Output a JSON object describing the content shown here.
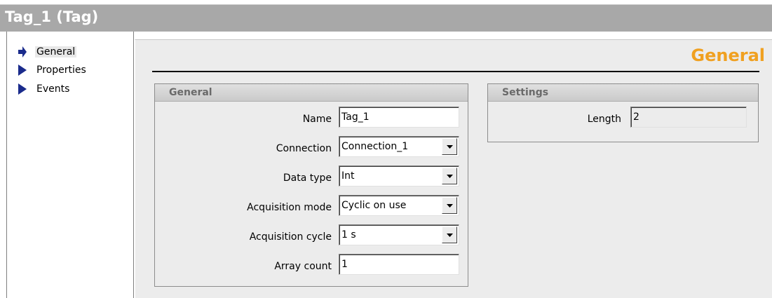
{
  "window": {
    "title": "Tag_1 (Tag)"
  },
  "nav": {
    "items": [
      {
        "label": "General",
        "selected": true
      },
      {
        "label": "Properties",
        "selected": false
      },
      {
        "label": "Events",
        "selected": false
      }
    ]
  },
  "main": {
    "title": "General",
    "title_color": "#f0a020",
    "general_group": {
      "header": "General",
      "fields": {
        "name": {
          "label": "Name",
          "value": "Tag_1"
        },
        "connection": {
          "label": "Connection",
          "value": "Connection_1"
        },
        "data_type": {
          "label": "Data type",
          "value": "Int"
        },
        "acquisition_mode": {
          "label": "Acquisition mode",
          "value": "Cyclic on use"
        },
        "acquisition_cycle": {
          "label": "Acquisition cycle",
          "value": "1 s"
        },
        "array_count": {
          "label": "Array count",
          "value": "1"
        }
      }
    },
    "settings_group": {
      "header": "Settings",
      "fields": {
        "length": {
          "label": "Length",
          "value": "2"
        }
      }
    }
  }
}
